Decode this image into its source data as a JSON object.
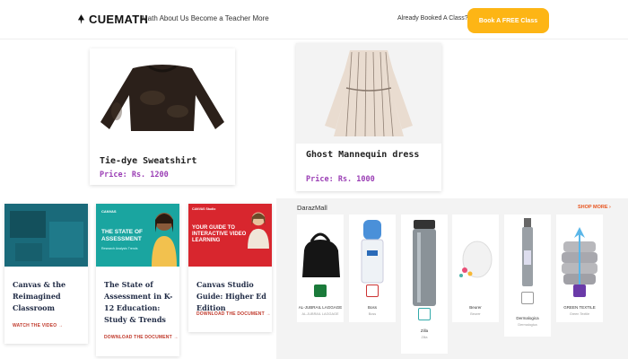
{
  "header": {
    "logo_text": "CUEMATH",
    "nav_text": "Math About Us Become a Teacher More",
    "booked_text": "Already Booked A Class?",
    "book_button": "Book A FREE Class",
    "brand_color": "#fdb515"
  },
  "products": [
    {
      "title": "Tie-dye Sweatshirt",
      "price": "Price: Rs. 1200"
    },
    {
      "title": "Ghost Mannequin dress",
      "price": "Price: Rs. 1000"
    }
  ],
  "canvas_cards": [
    {
      "title": "Canvas & the Reimagined Classroom",
      "link": "WATCH THE VIDEO",
      "thumb_text": ""
    },
    {
      "title": "The State of Assessment in K-12 Education: Study & Trends",
      "link": "DOWNLOAD THE DOCUMENT",
      "thumb_text": "THE STATE OF ASSESSMENT",
      "thumb_sub": "Research Analysis Trends",
      "thumb_brand": "CANVAS"
    },
    {
      "title": "Canvas Studio Guide: Higher Ed Edition",
      "link": "DOWNLOAD THE DOCUMENT",
      "thumb_text": "YOUR GUIDE TO INTERACTIVE VIDEO LEARNING",
      "thumb_brand": "CANVAS Studio"
    }
  ],
  "daraz": {
    "heading": "DarazMall",
    "shop_more": "SHOP MORE",
    "items": [
      {
        "name": "AL-JUBRAIL LAGGAGE",
        "sub": "AL-JUBRAIL LAGGAGE"
      },
      {
        "name": "Boss",
        "sub": "Boss"
      },
      {
        "name": "Zilla",
        "sub": "Zilla"
      },
      {
        "name": "Beurer",
        "sub": "Beurer"
      },
      {
        "name": "Dermalogica",
        "sub": "Dermalogica"
      },
      {
        "name": "GREEN TEXTILE",
        "sub": "Green Textile"
      }
    ]
  },
  "icons": [
    "rocket-icon",
    "chevron-right-icon",
    "arrow-right-icon"
  ]
}
